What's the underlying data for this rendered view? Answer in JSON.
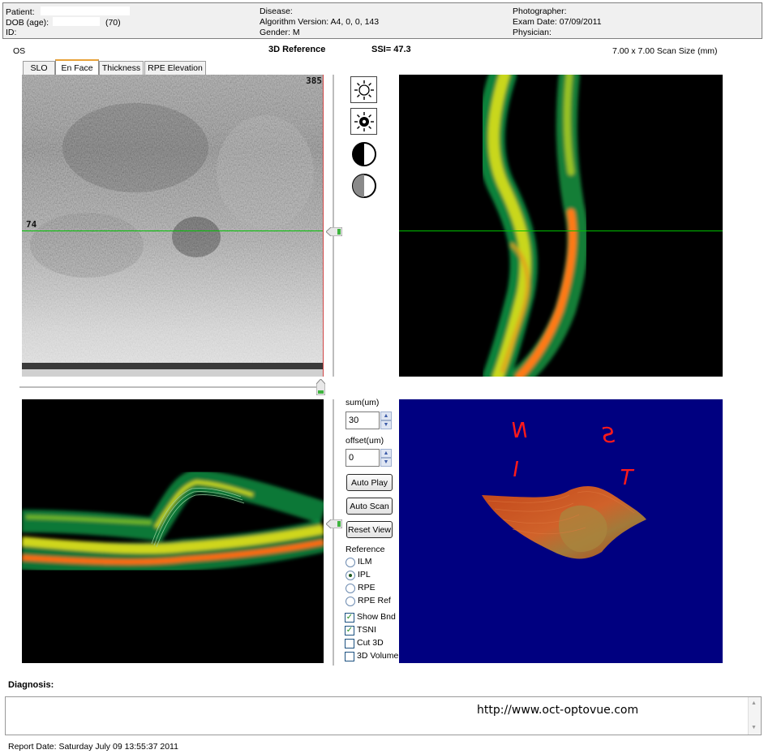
{
  "header": {
    "patient_label": "Patient:",
    "dob_label": "DOB (age):",
    "age": "(70)",
    "id_label": "ID:",
    "disease_label": "Disease:",
    "algorithm": "Algorithm Version: A4, 0, 0, 143",
    "gender": "Gender: M",
    "photographer_label": "Photographer:",
    "exam_date": "Exam Date: 07/09/2011",
    "physician_label": "Physician:"
  },
  "info": {
    "eye": "OS",
    "title": "3D Reference",
    "ssi": "SSI= 47.3",
    "scan_size": "7.00 x 7.00 Scan Size (mm)"
  },
  "tabs": [
    {
      "label": "SLO",
      "active": false
    },
    {
      "label": "En Face",
      "active": true
    },
    {
      "label": "Thickness",
      "active": false
    },
    {
      "label": "RPE Elevation",
      "active": false
    }
  ],
  "enface": {
    "top_right_label": "385",
    "left_label": "74"
  },
  "icons": [
    {
      "name": "brightness-up-icon"
    },
    {
      "name": "brightness-down-icon"
    },
    {
      "name": "contrast-icon"
    },
    {
      "name": "contrast-low-icon"
    }
  ],
  "controls": {
    "sum_label": "sum(um)",
    "sum_value": "30",
    "offset_label": "offset(um)",
    "offset_value": "0",
    "auto_play": "Auto Play",
    "auto_scan": "Auto Scan",
    "reset_view": "Reset View",
    "reference_label": "Reference",
    "reference_options": [
      {
        "label": "ILM",
        "selected": false
      },
      {
        "label": "IPL",
        "selected": true
      },
      {
        "label": "RPE",
        "selected": false
      },
      {
        "label": "RPE Ref",
        "selected": false
      }
    ],
    "checkboxes": [
      {
        "label": "Show Bnd",
        "checked": true
      },
      {
        "label": "TSNI",
        "checked": true
      },
      {
        "label": "Cut 3D",
        "checked": false
      },
      {
        "label": "3D Volume",
        "checked": false
      }
    ]
  },
  "view3d": {
    "labels": [
      "N",
      "S",
      "I",
      "T"
    ],
    "background": "#000080"
  },
  "diagnosis": {
    "label": "Diagnosis:",
    "url": "http://www.oct-optovue.com"
  },
  "footer": {
    "report_date": "Report Date: Saturday July 09 13:55:37 2011"
  },
  "colors": {
    "scan_line": "#00c000",
    "slider_handle": "#3fb43f"
  }
}
